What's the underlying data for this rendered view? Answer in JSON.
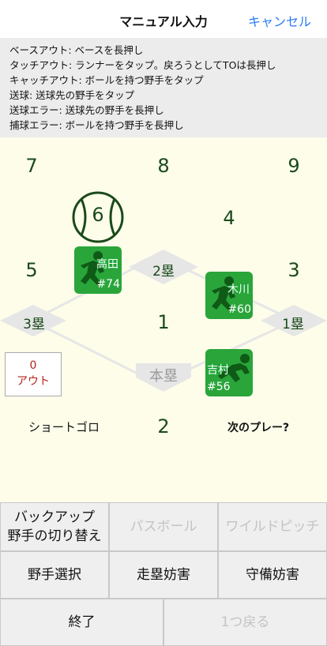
{
  "nav": {
    "title": "マニュアル入力",
    "cancel": "キャンセル"
  },
  "help": [
    "ベースアウト: ベースを長押し",
    "タッチアウト: ランナーをタップ。戻ろうとしてTOは長押し",
    "キャッチアウト: ボールを持つ野手をタップ",
    "送球: 送球先の野手をタップ",
    "送球エラー: 送球先の野手を長押し",
    "捕球エラー: ボールを持つ野手を長押し"
  ],
  "field": {
    "positions": {
      "p7": "7",
      "p8": "8",
      "p9": "9",
      "p6": "6",
      "p4": "4",
      "p5": "5",
      "p3": "3",
      "p1": "1",
      "p2": "2"
    },
    "bases": {
      "second": "2塁",
      "third": "3塁",
      "first": "1塁",
      "home": "本塁"
    },
    "runners": [
      {
        "name": "高田",
        "number": "#74"
      },
      {
        "name": "木川",
        "number": "#60"
      },
      {
        "name": "吉村",
        "number": "#56"
      }
    ],
    "outs": {
      "count": "0",
      "label": "アウト"
    },
    "play": "ショートゴロ",
    "next": "次のプレー?"
  },
  "buttons": {
    "backup": "バックアップ\n野手の切り替え",
    "passed_ball": "パスボール",
    "wild_pitch": "ワイルドピッチ",
    "fielder_select": "野手選択",
    "obstruction_run": "走塁妨害",
    "obstruction_def": "守備妨害",
    "finish": "終了",
    "undo": "1つ戻る"
  },
  "colors": {
    "accent": "#2b7bf6",
    "field_green": "#1a4a1a",
    "player_green": "#2aa53a",
    "out_red": "#b3221b"
  }
}
